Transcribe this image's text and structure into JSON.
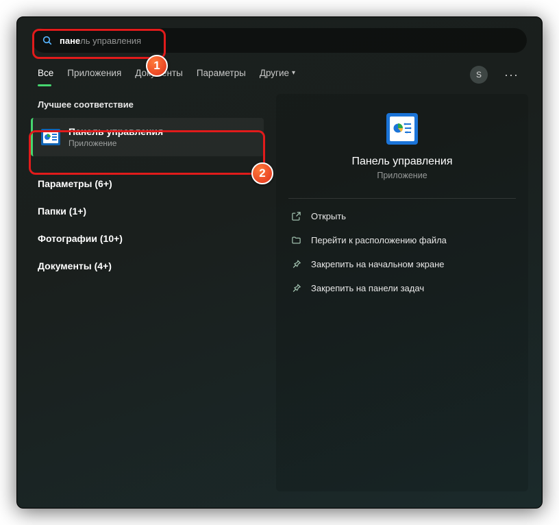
{
  "search": {
    "typed_bold": "пане",
    "typed_light": "ль управления"
  },
  "tabs": {
    "all": "Все",
    "apps": "Приложения",
    "docs": "Документы",
    "settings": "Параметры",
    "more": "Другие"
  },
  "avatar_letter": "S",
  "section_best_match": "Лучшее соответствие",
  "best_match": {
    "title": "Панель управления",
    "subtitle": "Приложение"
  },
  "categories": [
    "Параметры (6+)",
    "Папки (1+)",
    "Фотографии (10+)",
    "Документы (4+)"
  ],
  "preview": {
    "title": "Панель управления",
    "subtitle": "Приложение"
  },
  "actions": {
    "open": "Открыть",
    "location": "Перейти к расположению файла",
    "pin_start": "Закрепить на начальном экране",
    "pin_taskbar": "Закрепить на панели задач"
  },
  "badges": {
    "b1": "1",
    "b2": "2"
  }
}
